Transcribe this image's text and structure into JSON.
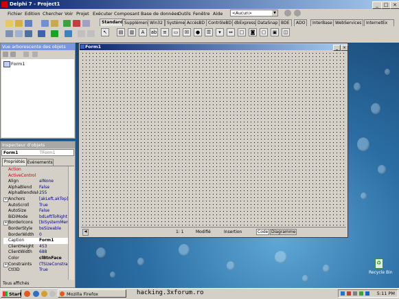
{
  "window": {
    "title": "Delphi 7 - Project1"
  },
  "menu": [
    "Fichier",
    "Edition",
    "Chercher",
    "Voir",
    "Projet",
    "Exécuter",
    "Composant",
    "Base de données",
    "Outils",
    "Fenêtre",
    "Aide"
  ],
  "config_combo": {
    "value": "<Aucun>"
  },
  "palette_tabs": [
    "Standard",
    "Supplément",
    "Win32",
    "Système",
    "AccèsBD",
    "ContrôleBD",
    "dbExpress",
    "DataSnap",
    "BDE",
    "ADO",
    "InterBase",
    "WebServices",
    "InternetEx"
  ],
  "object_tree": {
    "title": "Vue arborescente des objets",
    "item": "Form1"
  },
  "inspector": {
    "title": "Inspecteur d'objets",
    "selected_object": "Form1",
    "selected_type": "TForm1",
    "tabs": [
      "Propriétés",
      "Evénements"
    ],
    "rows": [
      {
        "name": "Action",
        "value": "",
        "red": true
      },
      {
        "name": "ActiveControl",
        "value": "",
        "red": true
      },
      {
        "name": "Align",
        "value": "alNone"
      },
      {
        "name": "AlphaBlend",
        "value": "False"
      },
      {
        "name": "AlphaBlendValue",
        "value": "255"
      },
      {
        "name": "Anchors",
        "value": "[akLeft,akTop]",
        "plus": true
      },
      {
        "name": "AutoScroll",
        "value": "True"
      },
      {
        "name": "AutoSize",
        "value": "False"
      },
      {
        "name": "BiDiMode",
        "value": "bdLeftToRight"
      },
      {
        "name": "BorderIcons",
        "value": "[biSystemMenu,bi",
        "plus": true
      },
      {
        "name": "BorderStyle",
        "value": "bsSizeable"
      },
      {
        "name": "BorderWidth",
        "value": "0"
      },
      {
        "name": "Caption",
        "value": "Form1",
        "bold": true,
        "selected": true
      },
      {
        "name": "ClientHeight",
        "value": "453"
      },
      {
        "name": "ClientWidth",
        "value": "688"
      },
      {
        "name": "Color",
        "value": "clBtnFace",
        "bold": true
      },
      {
        "name": "Constraints",
        "value": "(TSizeConstraints",
        "plus": true
      },
      {
        "name": "Ctl3D",
        "value": "True"
      }
    ],
    "footer": "Tous affichés"
  },
  "form": {
    "title": "Form1"
  },
  "editor_status": {
    "position": "1:   1",
    "modified": "Modifié",
    "mode": "Insertion",
    "tabs": [
      "Code",
      "Diagramme"
    ]
  },
  "desktop": {
    "icon_label": "Recycle Bin"
  },
  "taskbar": {
    "start": "Start",
    "task": "Mozilla Firefox",
    "clock": "5:11 PM"
  },
  "watermark": "hacking.3xforum.ro",
  "colors": {
    "title_gradient_start": "#0a246a",
    "title_gradient_end": "#a6caf0",
    "face": "#d4d0c8"
  }
}
